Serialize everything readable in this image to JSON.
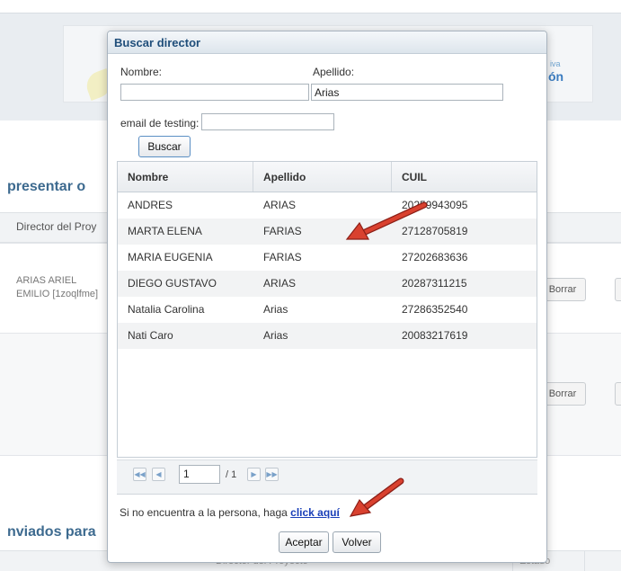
{
  "background": {
    "section_title_1": "presentar o",
    "section_title_2": "nviados para",
    "table_header": "Director del Proy",
    "row_text": "ARIAS ARIEL EMILIO [1zoqlfme]",
    "borrar_label": "Borrar",
    "logo_text_1": "iva",
    "logo_text_2": "ón",
    "footer_col_1": "Director del Proyecto",
    "footer_col_2": "Estado"
  },
  "modal": {
    "title": "Buscar director",
    "nombre_label": "Nombre:",
    "nombre_value": "",
    "apellido_label": "Apellido:",
    "apellido_value": "Arias",
    "email_label": "email de testing:",
    "email_value": "",
    "buscar_label": "Buscar",
    "columns": [
      "Nombre",
      "Apellido",
      "CUIL"
    ],
    "rows": [
      [
        "ANDRES",
        "ARIAS",
        "20259943095"
      ],
      [
        "MARTA ELENA",
        "FARIAS",
        "27128705819"
      ],
      [
        "MARIA EUGENIA",
        "FARIAS",
        "27202683636"
      ],
      [
        "DIEGO GUSTAVO",
        "ARIAS",
        "20287311215"
      ],
      [
        "Natalia Carolina",
        "Arias",
        "27286352540"
      ],
      [
        "Nati Caro",
        "Arias",
        "20083217619"
      ]
    ],
    "pager": {
      "page": "1",
      "total": "/ 1"
    },
    "hint_text": "Si no encuentra a la persona, haga ",
    "hint_link": "click aquí",
    "aceptar_label": "Aceptar",
    "volver_label": "Volver"
  },
  "colors": {
    "title_text": "#1f4e7a",
    "link": "#1a3fb8",
    "arrow": "#c8382c",
    "section_title": "#3d6a8f"
  }
}
